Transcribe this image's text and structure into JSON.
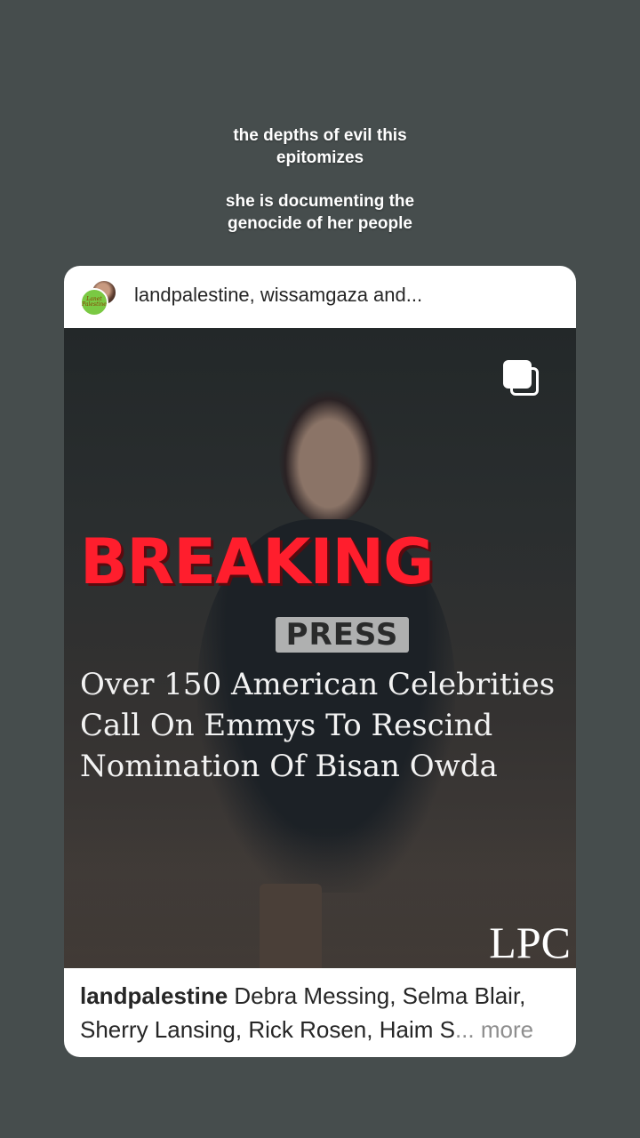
{
  "story": {
    "line1": "the depths of evil this",
    "line2": "epitomizes",
    "line3": "she is documenting the",
    "line4": "genocide of her people"
  },
  "card": {
    "header_title": "landpalestine, wissamgaza and...",
    "avatar_text": "Lanet Palestine",
    "post": {
      "breaking": "BREAKING",
      "press": "PRESS",
      "headline": [
        "Over 150 American Celebrities",
        "Call On Emmys To Rescind",
        "Nomination Of Bisan Owda"
      ],
      "watermark": "LPC",
      "multi_icon": "carousel-icon"
    },
    "caption": {
      "username": "landpalestine",
      "line1_text": " Debra Messing, Selma Blair,",
      "line2_text": "Sherry Lansing, Rick Rosen, Haim S",
      "ellipsis": "...",
      "more": " more"
    }
  },
  "colors": {
    "background": "#464d4d",
    "breaking_red": "#ff1e2d",
    "card_bg": "#ffffff",
    "more_gray": "#8e8e8e"
  }
}
